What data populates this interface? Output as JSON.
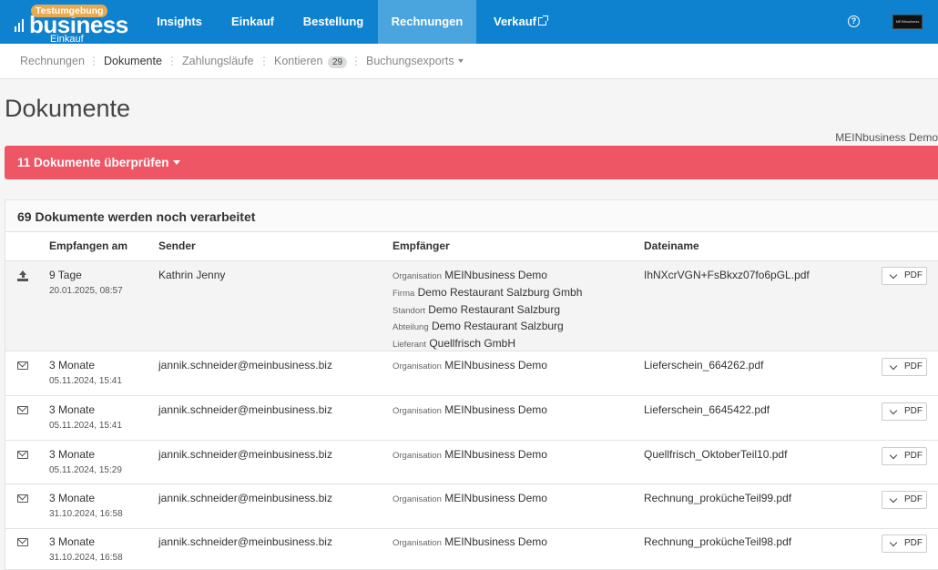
{
  "brand": {
    "env_badge": "Testumgebung",
    "name": "business",
    "sub": "Einkauf",
    "avatar_text": "MEINbusiness"
  },
  "topnav": [
    {
      "label": "Insights",
      "active": false
    },
    {
      "label": "Einkauf",
      "active": false
    },
    {
      "label": "Bestellung",
      "active": false
    },
    {
      "label": "Rechnungen",
      "active": true
    },
    {
      "label": "Verkauf",
      "active": false,
      "external": true
    }
  ],
  "help_icon": "question-circle-icon",
  "subnav": [
    {
      "label": "Rechnungen"
    },
    {
      "label": "Dokumente",
      "active": true
    },
    {
      "label": "Zahlungsläufe"
    },
    {
      "label": "Kontieren",
      "badge": "29"
    },
    {
      "label": "Buchungsexports",
      "dropdown": true
    }
  ],
  "page": {
    "title": "Dokumente",
    "organisation": "MEINbusiness Demo"
  },
  "alert": {
    "label": "11 Dokumente überprüfen",
    "color": "#ee5565"
  },
  "panel": {
    "title": "69 Dokumente werden noch verarbeitet",
    "columns": [
      "Empfangen am",
      "Sender",
      "Empfänger",
      "Dateiname"
    ],
    "pdf_label": "PDF",
    "rows": [
      {
        "icon": "upload-icon",
        "received": "9 Tage",
        "date": "20.01.2025, 08:57",
        "sender": "Kathrin Jenny",
        "recipient": [
          {
            "label": "Organisation",
            "value": "MEINbusiness Demo"
          },
          {
            "label": "Firma",
            "value": "Demo Restaurant Salzburg Gmbh"
          },
          {
            "label": "Standort",
            "value": "Demo Restaurant Salzburg"
          },
          {
            "label": "Abteilung",
            "value": "Demo Restaurant Salzburg"
          },
          {
            "label": "Lieferant",
            "value": "Quellfrisch GmbH"
          }
        ],
        "filename": "IhNXcrVGN+FsBkxz07fo6pGL.pdf"
      },
      {
        "icon": "envelope-icon",
        "received": "3 Monate",
        "date": "05.11.2024, 15:41",
        "sender": "jannik.schneider@meinbusiness.biz",
        "recipient": [
          {
            "label": "Organisation",
            "value": "MEINbusiness Demo"
          }
        ],
        "filename": "Lieferschein_664262.pdf"
      },
      {
        "icon": "envelope-icon",
        "received": "3 Monate",
        "date": "05.11.2024, 15:41",
        "sender": "jannik.schneider@meinbusiness.biz",
        "recipient": [
          {
            "label": "Organisation",
            "value": "MEINbusiness Demo"
          }
        ],
        "filename": "Lieferschein_6645422.pdf"
      },
      {
        "icon": "envelope-icon",
        "received": "3 Monate",
        "date": "05.11.2024, 15:29",
        "sender": "jannik.schneider@meinbusiness.biz",
        "recipient": [
          {
            "label": "Organisation",
            "value": "MEINbusiness Demo"
          }
        ],
        "filename": "Quellfrisch_OktoberTeil10.pdf"
      },
      {
        "icon": "envelope-icon",
        "received": "3 Monate",
        "date": "31.10.2024, 16:58",
        "sender": "jannik.schneider@meinbusiness.biz",
        "recipient": [
          {
            "label": "Organisation",
            "value": "MEINbusiness Demo"
          }
        ],
        "filename": "Rechnung_proküche Teil99.pdf"
      },
      {
        "icon": "envelope-icon",
        "received": "3 Monate",
        "date": "31.10.2024, 16:58",
        "sender": "jannik.schneider@meinbusiness.biz",
        "recipient": [
          {
            "label": "Organisation",
            "value": "MEINbusiness Demo"
          }
        ],
        "filename": "Rechnung_prokücheTeil98.pdf"
      }
    ]
  }
}
